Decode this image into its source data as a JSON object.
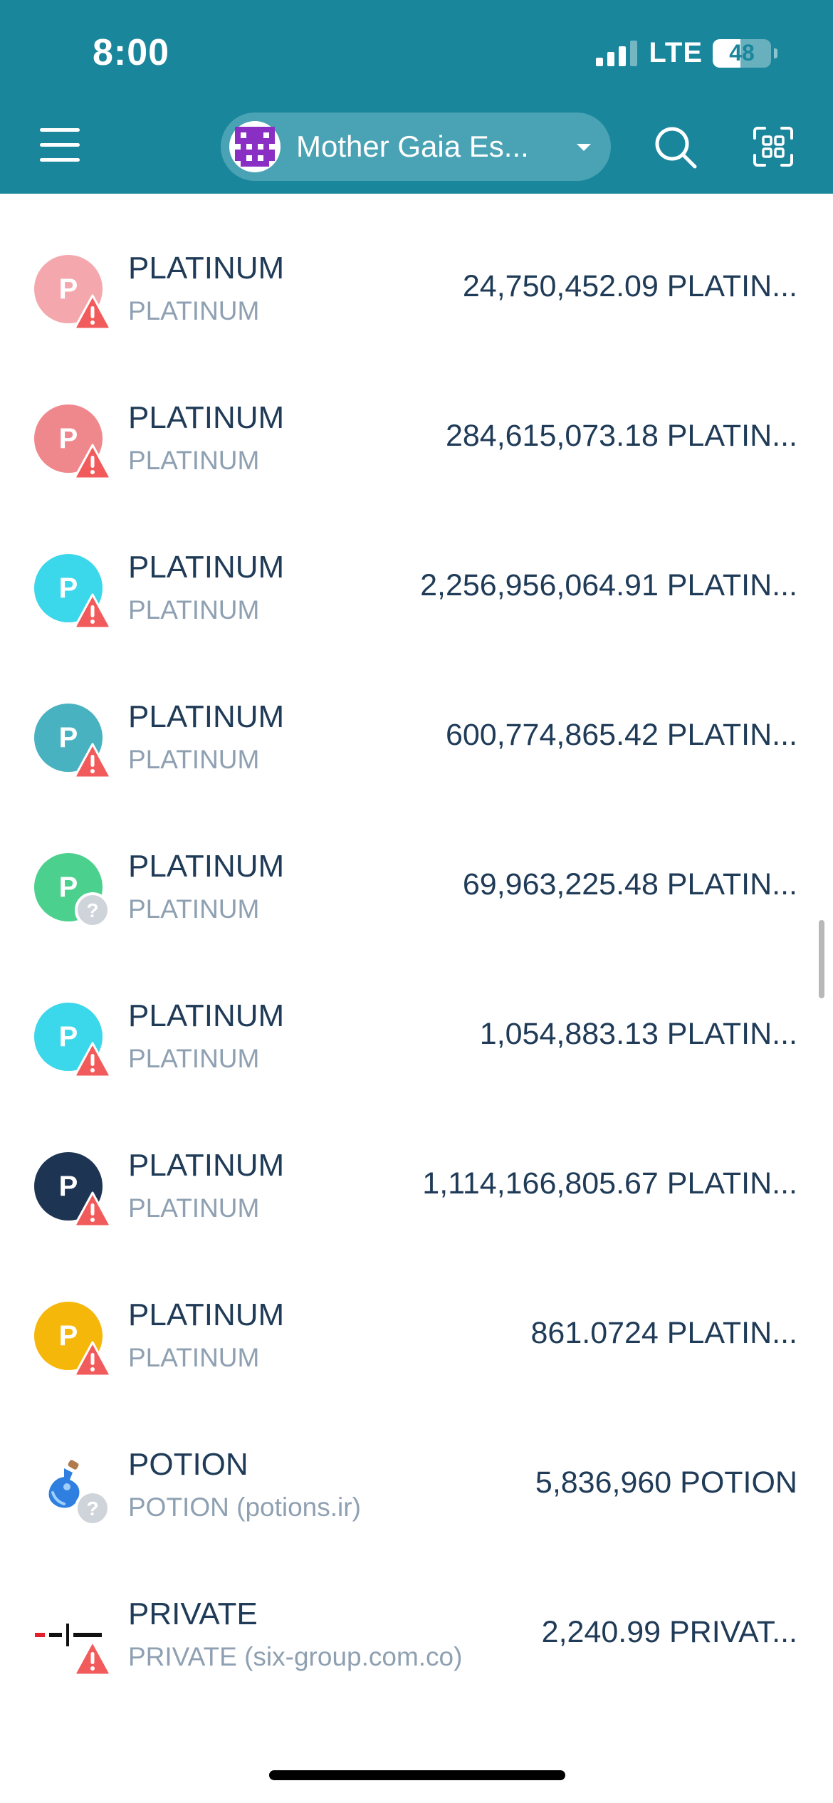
{
  "status_bar": {
    "time": "8:00",
    "network": "LTE",
    "battery": "48",
    "battery_fraction": 0.48
  },
  "header": {
    "account_name": "Mother Gaia Es...",
    "avatar_color": "#8a2fc4",
    "bg_color": "#1a869c"
  },
  "tokens": [
    {
      "name": "PLATINUM",
      "subtitle": "PLATINUM",
      "amount": "24,750,452.09 PLATIN...",
      "icon_color": "#f4a8ad",
      "icon_letter": "P",
      "badge": "warning-icon"
    },
    {
      "name": "PLATINUM",
      "subtitle": "PLATINUM",
      "amount": "284,615,073.18 PLATIN...",
      "icon_color": "#ef888d",
      "icon_letter": "P",
      "badge": "warning-icon"
    },
    {
      "name": "PLATINUM",
      "subtitle": "PLATINUM",
      "amount": "2,256,956,064.91 PLATIN...",
      "icon_color": "#3bd7ea",
      "icon_letter": "P",
      "badge": "warning-icon"
    },
    {
      "name": "PLATINUM",
      "subtitle": "PLATINUM",
      "amount": "600,774,865.42 PLATIN...",
      "icon_color": "#49b2c0",
      "icon_letter": "P",
      "badge": "warning-icon"
    },
    {
      "name": "PLATINUM",
      "subtitle": "PLATINUM",
      "amount": "69,963,225.48 PLATIN...",
      "icon_color": "#4cd08e",
      "icon_letter": "P",
      "badge": "question-icon"
    },
    {
      "name": "PLATINUM",
      "subtitle": "PLATINUM",
      "amount": "1,054,883.13 PLATIN...",
      "icon_color": "#3bd7ea",
      "icon_letter": "P",
      "badge": "warning-icon"
    },
    {
      "name": "PLATINUM",
      "subtitle": "PLATINUM",
      "amount": "1,114,166,805.67 PLATIN...",
      "icon_color": "#1d3553",
      "icon_letter": "P",
      "badge": "warning-icon"
    },
    {
      "name": "PLATINUM",
      "subtitle": "PLATINUM",
      "amount": "861.0724 PLATIN...",
      "icon_color": "#f6b70b",
      "icon_letter": "P",
      "badge": "warning-icon"
    },
    {
      "name": "POTION",
      "subtitle": "POTION (potions.ir)",
      "amount": "5,836,960 POTION",
      "icon_color": "#ffffff",
      "icon_letter": "",
      "icon_kind": "potion-icon",
      "badge": "question-icon"
    },
    {
      "name": "PRIVATE",
      "subtitle": "PRIVATE (six-group.com.co)",
      "amount": "2,240.99 PRIVAT...",
      "icon_color": "#ffffff",
      "icon_letter": "",
      "icon_kind": "private-logo-icon",
      "badge": "warning-icon"
    }
  ]
}
